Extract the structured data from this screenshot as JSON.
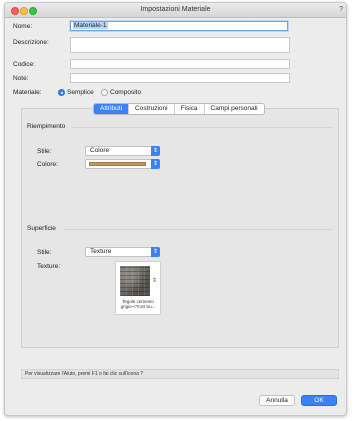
{
  "window": {
    "title": "Impostazioni Materiale",
    "help": "?"
  },
  "form": {
    "nome_label": "Nome:",
    "nome_value": "Materiale-1",
    "descrizione_label": "Descrizione:",
    "descrizione_value": "",
    "codice_label": "Codice:",
    "codice_value": "",
    "note_label": "Note:",
    "note_value": "",
    "materiale_label": "Materiale:",
    "materiale_options": [
      "Semplice",
      "Composito"
    ],
    "materiale_selected": "Semplice"
  },
  "tabs": [
    "Attributi",
    "Costruzioni",
    "Fisica",
    "Campi personali"
  ],
  "active_tab": "Attributi",
  "riempimento": {
    "title": "Riempimento",
    "stile_label": "Stile:",
    "stile_value": "Colore",
    "colore_label": "Colore:",
    "colore_value_hex": "#c8955f"
  },
  "superficie": {
    "title": "Superficie",
    "stile_label": "Stile:",
    "stile_value": "Texture",
    "texture_label": "Texture:",
    "texture_caption": "Tegole cemento grigio-<Trott Su..."
  },
  "status": "Per visualizzare l'Aiuto, premi F1 o fai clic sull'icona ?",
  "buttons": {
    "cancel": "Annulla",
    "ok": "OK"
  },
  "icons": {
    "popup_arrows": "updown-chevron-icon",
    "texture_stepper": "updown-chevron-icon"
  },
  "colors": {
    "accent": "#3b82f6",
    "panel_bg": "#e6e6e6"
  }
}
